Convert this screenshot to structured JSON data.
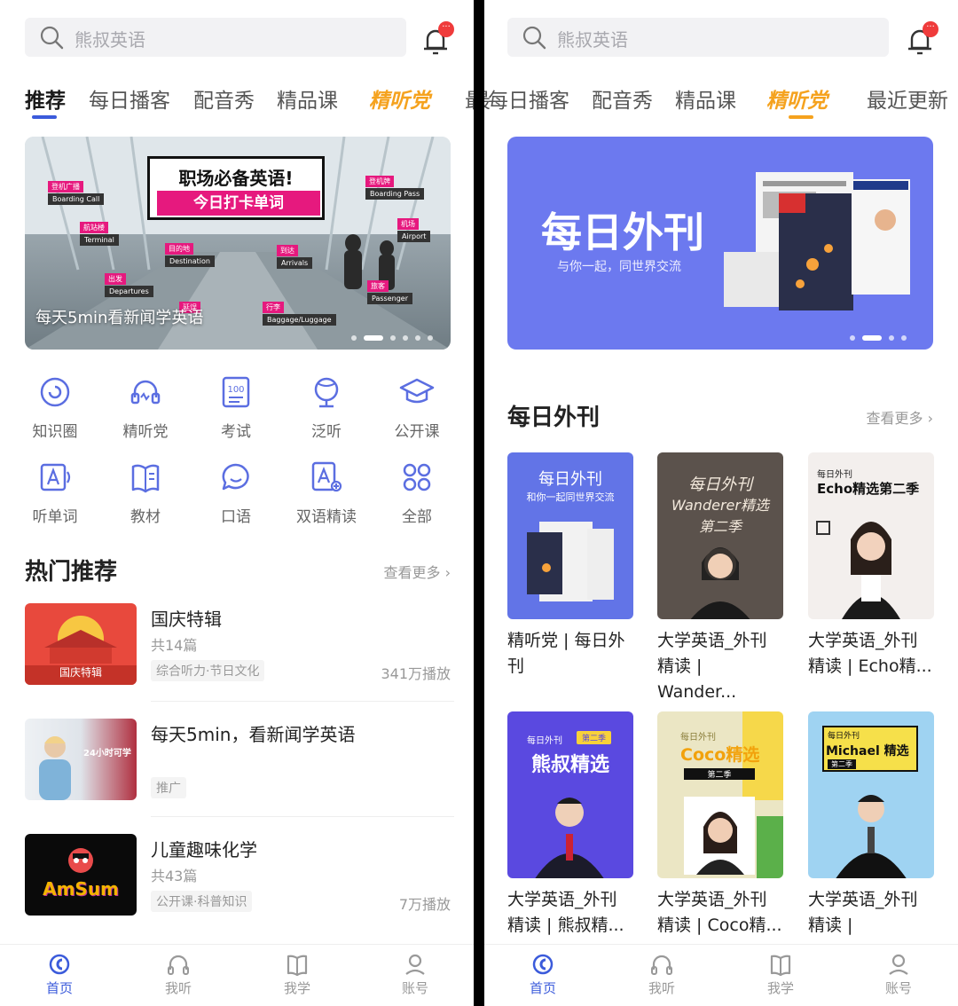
{
  "search": {
    "placeholder": "熊叔英语"
  },
  "notification": {
    "badge": "···"
  },
  "left": {
    "tabs": [
      "推荐",
      "每日播客",
      "配音秀",
      "精品课",
      "精听党",
      "最"
    ],
    "banner": {
      "sign_title": "职场必备英语!",
      "sign_subtitle": "今日打卡单词",
      "caption": "每天5min看新闻学英语",
      "tags": [
        {
          "cn": "登机广播",
          "en": "Boarding Call"
        },
        {
          "cn": "航站楼",
          "en": "Terminal"
        },
        {
          "cn": "目的地",
          "en": "Destination"
        },
        {
          "cn": "出发",
          "en": "Departures"
        },
        {
          "cn": "到达",
          "en": "Arrivals"
        },
        {
          "cn": "登机牌",
          "en": "Boarding Pass"
        },
        {
          "cn": "机场",
          "en": "Airport"
        },
        {
          "cn": "旅客",
          "en": "Passenger"
        },
        {
          "cn": "行李",
          "en": "Baggage/Luggage"
        },
        {
          "cn": "延误",
          "en": ""
        }
      ]
    },
    "icons": [
      {
        "label": "知识圈",
        "icon": "knowledge-circle-icon"
      },
      {
        "label": "精听党",
        "icon": "headset-icon"
      },
      {
        "label": "考试",
        "icon": "exam-100-icon"
      },
      {
        "label": "泛听",
        "icon": "globe-icon"
      },
      {
        "label": "公开课",
        "icon": "graduation-cap-icon"
      },
      {
        "label": "听单词",
        "icon": "word-listen-icon"
      },
      {
        "label": "教材",
        "icon": "book-icon"
      },
      {
        "label": "口语",
        "icon": "speech-bubble-icon"
      },
      {
        "label": "双语精读",
        "icon": "bilingual-read-icon"
      },
      {
        "label": "全部",
        "icon": "grid-all-icon"
      }
    ],
    "hot_section": {
      "title": "热门推荐",
      "more": "查看更多",
      "items": [
        {
          "title": "国庆特辑",
          "count": "共14篇",
          "tag": "综合听力·节日文化",
          "plays": "341万播放",
          "thumb_label": "国庆特辑"
        },
        {
          "title": "每天5min，看新闻学英语",
          "count": "",
          "tag": "推广",
          "plays": "",
          "thumb_label": "24小时可学"
        },
        {
          "title": "儿童趣味化学",
          "count": "共43篇",
          "tag": "公开课·科普知识",
          "plays": "7万播放",
          "thumb_label": "AmSum"
        }
      ]
    }
  },
  "right": {
    "tabs": [
      "最",
      "每日播客",
      "配音秀",
      "精品课",
      "精听党",
      "最近更新"
    ],
    "banner": {
      "title": "每日外刊",
      "subtitle": "与你一起，同世界交流"
    },
    "section": {
      "title": "每日外刊",
      "more": "查看更多"
    },
    "cards": [
      {
        "line1": "精听党 | 每日外",
        "line2": "刊",
        "cover_title": "每日外刊",
        "cover_sub": "和你一起同世界交流"
      },
      {
        "line1": "大学英语_外刊",
        "line2": "精读 | Wander...",
        "cover_title": "每日外刊",
        "cover_sub": "Wanderer精选\n第二季"
      },
      {
        "line1": "大学英语_外刊",
        "line2": "精读 | Echo精...",
        "cover_title": "每日外刊",
        "cover_sub": "Echo精选第二季"
      },
      {
        "line1": "大学英语_外刊",
        "line2": "精读 | 熊叔精...",
        "cover_title": "熊叔精选",
        "cover_sub": "第二季"
      },
      {
        "line1": "大学英语_外刊",
        "line2": "精读 | Coco精...",
        "cover_title": "Coco精选",
        "cover_sub": "第二季"
      },
      {
        "line1": "大学英语_外刊",
        "line2": "精读 | Michael...",
        "cover_title": "Michael 精选",
        "cover_sub": "第二季"
      }
    ]
  },
  "bottom_nav": [
    {
      "label": "首页",
      "icon": "home-icon",
      "active": true
    },
    {
      "label": "我听",
      "icon": "headphones-icon",
      "active": false
    },
    {
      "label": "我学",
      "icon": "open-book-icon",
      "active": false
    },
    {
      "label": "账号",
      "icon": "user-icon",
      "active": false
    }
  ],
  "colors": {
    "accent": "#3b5bdb",
    "brand_yellow": "#f5a21e",
    "magenta": "#e6197e",
    "banner_blue": "#6c79ef"
  }
}
